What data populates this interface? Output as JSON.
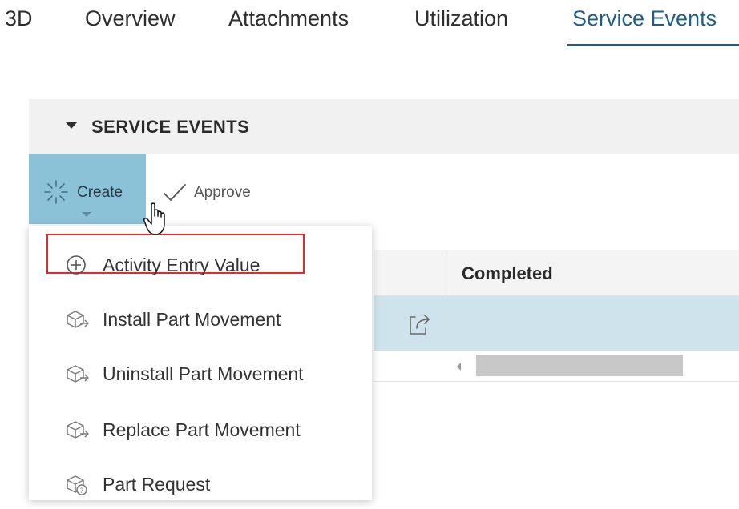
{
  "tabs": [
    {
      "label": "3D",
      "active": false
    },
    {
      "label": "Overview",
      "active": false
    },
    {
      "label": "Attachments",
      "active": false
    },
    {
      "label": "Utilization",
      "active": false
    },
    {
      "label": "Service Events",
      "active": true
    }
  ],
  "panel": {
    "title": "SERVICE EVENTS",
    "expanded": true
  },
  "toolbar": {
    "create_label": "Create",
    "approve_label": "Approve"
  },
  "grid": {
    "columns": [
      "Completed"
    ]
  },
  "create_menu": {
    "items": [
      {
        "label": "Activity Entry Value",
        "icon": "plus-circle-icon",
        "highlighted": true
      },
      {
        "label": "Install Part Movement",
        "icon": "part-movement-icon",
        "highlighted": false
      },
      {
        "label": "Uninstall Part Movement",
        "icon": "part-movement-icon",
        "highlighted": false
      },
      {
        "label": "Replace Part Movement",
        "icon": "part-movement-icon",
        "highlighted": false
      },
      {
        "label": "Part Request",
        "icon": "part-request-icon",
        "highlighted": false
      }
    ]
  },
  "colors": {
    "accent": "#1f5f84",
    "create_button_bg": "#8cc2d8",
    "selected_row_bg": "#cfe3ec",
    "highlight_border": "#e5292b"
  }
}
